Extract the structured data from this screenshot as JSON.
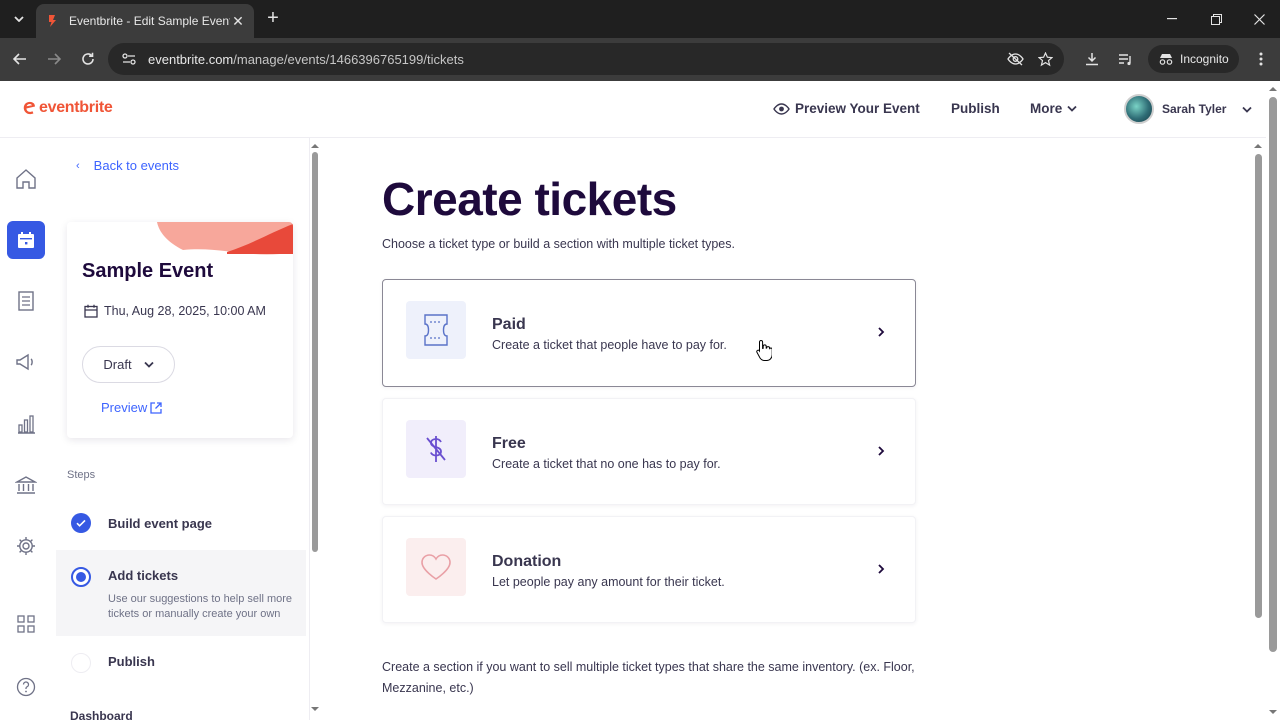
{
  "browser": {
    "tab_title": "Eventbrite - Edit Sample Event",
    "url_host": "eventbrite.com",
    "url_path": "/manage/events/1466396765199/tickets",
    "incognito_label": "Incognito"
  },
  "header": {
    "logo": "eventbrite",
    "preview_label": "Preview Your Event",
    "publish_label": "Publish",
    "more_label": "More",
    "user_name": "Sarah Tyler"
  },
  "sidebar": {
    "back_label": "Back to events",
    "event_name": "Sample Event",
    "event_date": "Thu, Aug 28, 2025, 10:00 AM",
    "status": "Draft",
    "preview_label": "Preview",
    "steps_label": "Steps",
    "steps": [
      {
        "title": "Build event page",
        "state": "complete"
      },
      {
        "title": "Add tickets",
        "state": "active",
        "desc": "Use our suggestions to help sell more tickets or manually create your own"
      },
      {
        "title": "Publish",
        "state": "pending"
      }
    ],
    "dashboard_label": "Dashboard"
  },
  "main": {
    "title": "Create tickets",
    "subtitle": "Choose a ticket type or build a section with multiple ticket types.",
    "tickets": [
      {
        "name": "Paid",
        "desc": "Create a ticket that people have to pay for.",
        "icon": "ticket-icon"
      },
      {
        "name": "Free",
        "desc": "Create a ticket that no one has to pay for.",
        "icon": "no-dollar-icon"
      },
      {
        "name": "Donation",
        "desc": "Let people pay any amount for their ticket.",
        "icon": "heart-icon"
      }
    ],
    "section_note": "Create a section if you want to sell multiple ticket types that share the same inventory. (ex. Floor, Mezzanine, etc.)"
  },
  "colors": {
    "brand": "#f05537",
    "link": "#3d64ff",
    "active_rail": "#3659e3",
    "title": "#1e0a3c"
  }
}
